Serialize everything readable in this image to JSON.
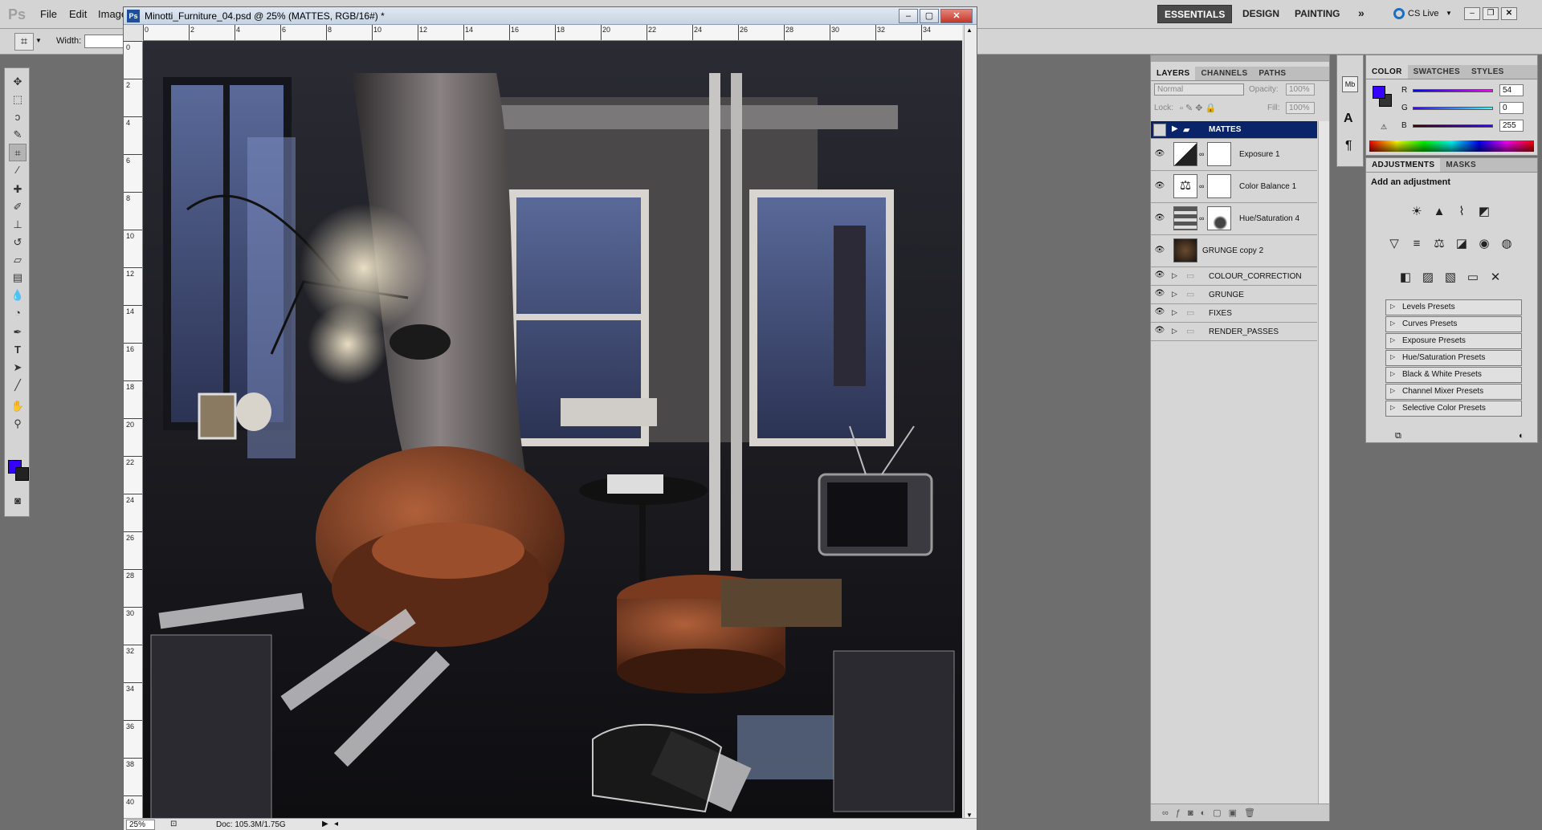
{
  "app": {
    "logo": "Ps"
  },
  "menu": [
    "File",
    "Edit",
    "Image"
  ],
  "workspaces": {
    "essentials": "ESSENTIALS",
    "design": "DESIGN",
    "painting": "PAINTING",
    "more": "»",
    "cslive": "CS Live"
  },
  "options_bar": {
    "width_label": "Width:"
  },
  "document": {
    "title": "Minotti_Furniture_04.psd @ 25% (MATTES, RGB/16#) *",
    "zoom": "25%",
    "doc_size": "Doc: 105.3M/1.75G",
    "ruler_h": [
      "0",
      "2",
      "4",
      "6",
      "8",
      "10",
      "12",
      "14",
      "16",
      "18",
      "20",
      "22",
      "24",
      "26",
      "28",
      "30",
      "32",
      "34"
    ],
    "ruler_v": [
      "0",
      "2",
      "4",
      "6",
      "8",
      "10",
      "12",
      "14",
      "16",
      "18",
      "20",
      "22",
      "24",
      "26",
      "28",
      "30",
      "32",
      "34",
      "36",
      "38",
      "40"
    ]
  },
  "layers_panel": {
    "tabs": [
      "LAYERS",
      "CHANNELS",
      "PATHS"
    ],
    "blend_mode": "Normal",
    "opacity_label": "Opacity:",
    "opacity_value": "100%",
    "lock_label": "Lock:",
    "fill_label": "Fill:",
    "fill_value": "100%",
    "layers": [
      {
        "name": "MATTES",
        "type": "group",
        "selected": true,
        "visible": false
      },
      {
        "name": "Exposure 1",
        "type": "adjustment",
        "visible": true
      },
      {
        "name": "Color Balance 1",
        "type": "adjustment",
        "visible": true
      },
      {
        "name": "Hue/Saturation 4",
        "type": "adjustment",
        "visible": true
      },
      {
        "name": "GRUNGE copy 2",
        "type": "image",
        "visible": true
      },
      {
        "name": "COLOUR_CORRECTION",
        "type": "group",
        "visible": true
      },
      {
        "name": "GRUNGE",
        "type": "group",
        "visible": true
      },
      {
        "name": "FIXES",
        "type": "group",
        "visible": true
      },
      {
        "name": "RENDER_PASSES",
        "type": "group",
        "visible": true
      }
    ]
  },
  "color_panel": {
    "tabs": [
      "COLOR",
      "SWATCHES",
      "STYLES"
    ],
    "r_label": "R",
    "g_label": "G",
    "b_label": "B",
    "r": "54",
    "g": "0",
    "b": "255",
    "foreground": "#3600ff"
  },
  "adjustments_panel": {
    "tabs": [
      "ADJUSTMENTS",
      "MASKS"
    ],
    "heading": "Add an adjustment",
    "presets": [
      "Levels Presets",
      "Curves Presets",
      "Exposure Presets",
      "Hue/Saturation Presets",
      "Black & White Presets",
      "Channel Mixer Presets",
      "Selective Color Presets"
    ]
  },
  "colors": {
    "selection": "#0a246a",
    "accent": "#3600ff"
  }
}
